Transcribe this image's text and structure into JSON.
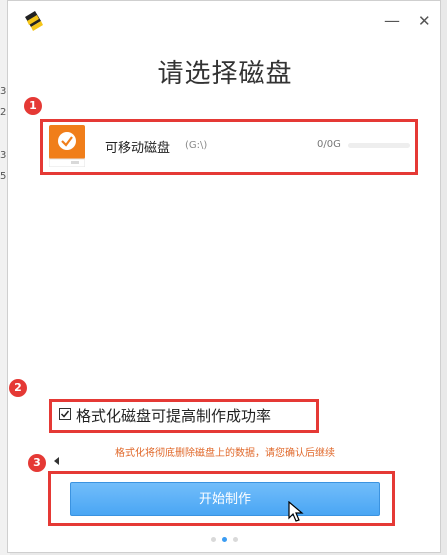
{
  "background_app": {
    "digits": [
      "3",
      "2",
      "3",
      "5"
    ]
  },
  "window": {
    "minimize_glyph": "—",
    "close_glyph": "✕"
  },
  "page_title": "请选择磁盘",
  "annotations": {
    "badge_1": "1",
    "badge_2": "2",
    "badge_3": "3",
    "highlight_color": "#e53935"
  },
  "disk": {
    "name": "可移动磁盘",
    "path": "(G:\\)",
    "size": "0/0G",
    "usage_fraction": 0,
    "icon": "usb-drive-checked-icon"
  },
  "format_option": {
    "checked": true,
    "label": "格式化磁盘可提高制作成功率"
  },
  "warning": "格式化将彻底删除磁盘上的数据，请您确认后继续",
  "start_button_label": "开始制作",
  "pager": {
    "pages": 3,
    "active": 1
  },
  "colors": {
    "accent": "#3b9cf2",
    "button": "#4aa6f4",
    "warning": "#e0682a",
    "disk_icon": "#f07e1a"
  }
}
